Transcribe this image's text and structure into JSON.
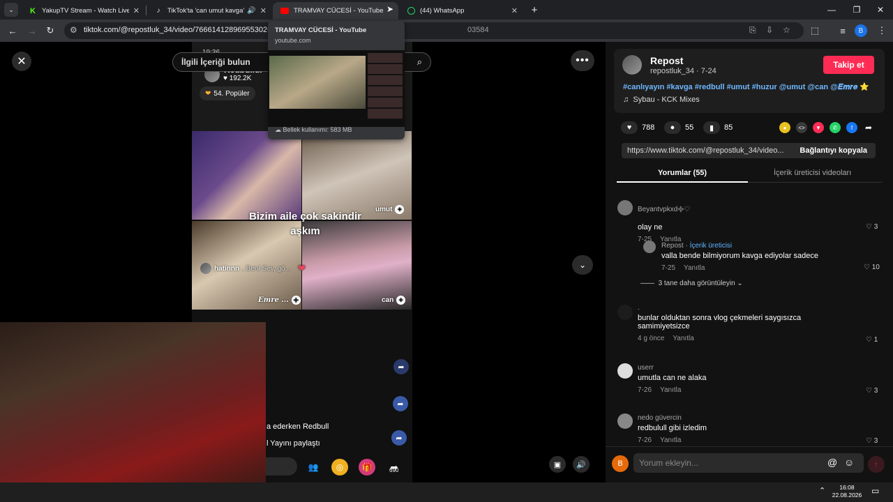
{
  "browser": {
    "tabs": [
      {
        "title": "YakupTV Stream - Watch Live o",
        "favicon": "kick-icon",
        "color": "#53fc18"
      },
      {
        "title": "TikTok'ta 'can umut kavga' ",
        "favicon": "tiktok-icon",
        "color": "#ffffff"
      },
      {
        "title": "TRAMVAY CÜCESİ - YouTube",
        "favicon": "youtube-icon",
        "color": "#ff0000"
      },
      {
        "title": "(44) WhatsApp",
        "favicon": "whatsapp-icon",
        "color": "#25d366"
      }
    ],
    "new_tab": "+",
    "url": "tiktok.com/@repostluk_34/video/7666141289695530260",
    "url_tail": "03584",
    "profile_initial": "B"
  },
  "hovercard": {
    "title": "TRAMVAY CÜCESİ - YouTube",
    "domain": "youtube.com",
    "memory": "Bellek kullanımı: 583 MB"
  },
  "video": {
    "search_placeholder": "İlgili İçeriği bulun",
    "live_time": "19:36",
    "live_name": "Redbullul",
    "likes": "192.2K",
    "popular": "54. Popüler",
    "caption_line1": "Bizim aile çok sakindir",
    "caption_line2": "aşkım",
    "tag_umut": "umut",
    "tag_hatinnn": "hatinnn",
    "tag_hatinnn_rest": ", Beni Sev, gö...",
    "tag_emre": "Emre ...",
    "tag_can": "can",
    "chat1": "a ederken Redbull",
    "chat2": "l Yayını paylaştı",
    "share_count": "690"
  },
  "post": {
    "username": "Repost",
    "handle_date": "repostluk_34 · 7-24",
    "follow": "Takip et",
    "hashtags": "#canlıyayın #kavga #redbull #umut #huzur @umut @can @𝑬𝒎𝒓𝒆 ⭐",
    "music": "Sybau - KCK Mixes",
    "likes": "788",
    "comments": "55",
    "saves": "85",
    "link": "https://www.tiktok.com/@repostluk_34/video...",
    "copy_link": "Bağlantıyı kopyala",
    "tab_comments": "Yorumlar (55)",
    "tab_creator": "İçerik üreticisi videoları"
  },
  "comments": [
    {
      "name": "Beyantvpkxd࿇♡",
      "text": "olay ne",
      "date": "7-25",
      "reply": "Yanıtla",
      "likes": "3"
    },
    {
      "name": "Repost",
      "badge": "İçerik üreticisi",
      "text": "valla bende bilmiyorum kavga ediyolar sadece",
      "date": "7-25",
      "reply": "Yanıtla",
      "likes": "10"
    },
    {
      "name": ".",
      "text": "bunlar olduktan sonra vlog çekmeleri saygısızca samimiyetsizce",
      "date": "4 g önce",
      "reply": "Yanıtla",
      "likes": "1"
    },
    {
      "name": "userr",
      "text": "umutla can ne alaka",
      "date": "7-26",
      "reply": "Yanıtla",
      "likes": "3"
    },
    {
      "name": "nedo güvercin",
      "text": "redbulull gibi izledim",
      "date": "7-26",
      "reply": "Yanıtla",
      "likes": "3"
    }
  ],
  "more_replies": "3 tane daha görüntüleyin",
  "input": {
    "placeholder": "Yorum ekleyin...",
    "avatar_initial": "B"
  },
  "taskbar": {
    "time": "16:08",
    "date": "22.08.2026"
  }
}
